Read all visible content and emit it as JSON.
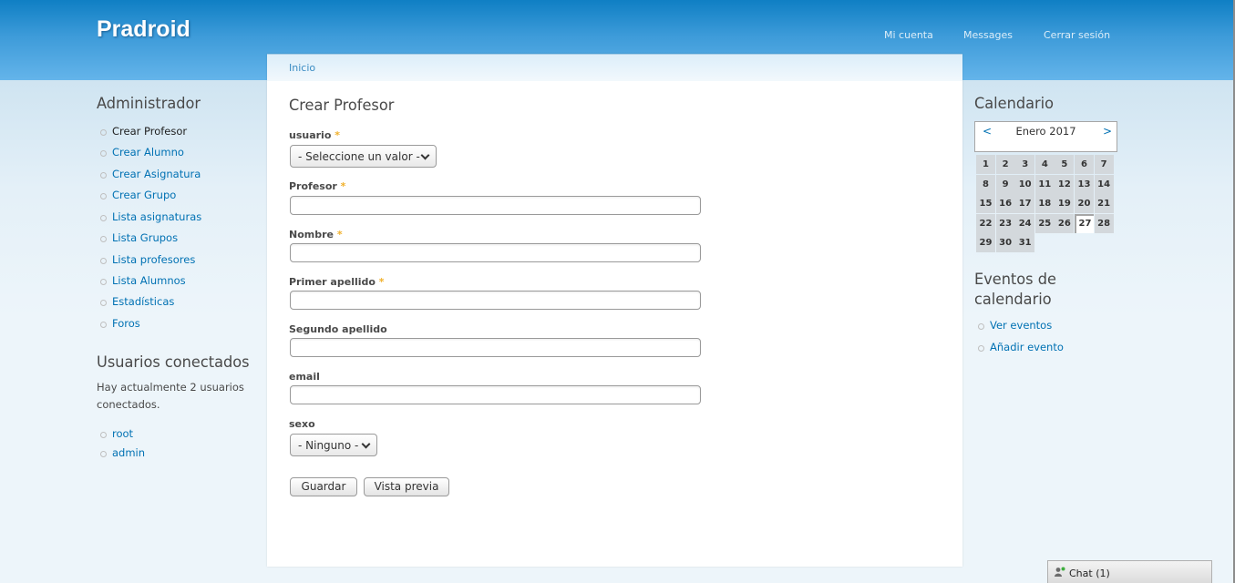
{
  "site": {
    "name": "Pradroid"
  },
  "topnav": {
    "account": "Mi cuenta",
    "messages": "Messages",
    "logout": "Cerrar sesión"
  },
  "breadcrumb": "Inicio",
  "page_title": "Crear Profesor",
  "form": {
    "required_mark": "*",
    "usuario": {
      "label": "usuario",
      "value": "- Seleccione un valor -"
    },
    "profesor": {
      "label": "Profesor",
      "value": ""
    },
    "nombre": {
      "label": "Nombre",
      "value": ""
    },
    "primer_apellido": {
      "label": "Primer apellido",
      "value": ""
    },
    "segundo_apellido": {
      "label": "Segundo apellido",
      "value": ""
    },
    "email": {
      "label": "email",
      "value": ""
    },
    "sexo": {
      "label": "sexo",
      "value": "- Ninguno -"
    },
    "save_label": "Guardar",
    "preview_label": "Vista previa"
  },
  "admin_menu": {
    "title": "Administrador",
    "items": [
      "Crear Profesor",
      "Crear Alumno",
      "Crear Asignatura",
      "Crear Grupo",
      "Lista asignaturas",
      "Lista Grupos",
      "Lista profesores",
      "Lista Alumnos",
      "Estadísticas",
      "Foros"
    ],
    "active_index": 0
  },
  "online_users": {
    "title": "Usuarios conectados",
    "summary": "Hay actualmente 2 usuarios conectados.",
    "users": [
      "root",
      "admin"
    ]
  },
  "calendar": {
    "title": "Calendario",
    "prev": "<",
    "next": ">",
    "month": "Enero 2017",
    "today": 27,
    "days": [
      "1",
      "2",
      "3",
      "4",
      "5",
      "6",
      "7",
      "8",
      "9",
      "10",
      "11",
      "12",
      "13",
      "14",
      "15",
      "16",
      "17",
      "18",
      "19",
      "20",
      "21",
      "22",
      "23",
      "24",
      "25",
      "26",
      "27",
      "28",
      "29",
      "30",
      "31"
    ]
  },
  "events": {
    "title_line1": "Eventos de",
    "title_line2": "calendario",
    "items": [
      "Ver eventos",
      "Añadir evento"
    ]
  },
  "chat": {
    "label": "Chat (1)"
  },
  "colors": {
    "header_blue": "#3d9bd9",
    "link": "#0071b3",
    "required": "#f1b12c"
  }
}
